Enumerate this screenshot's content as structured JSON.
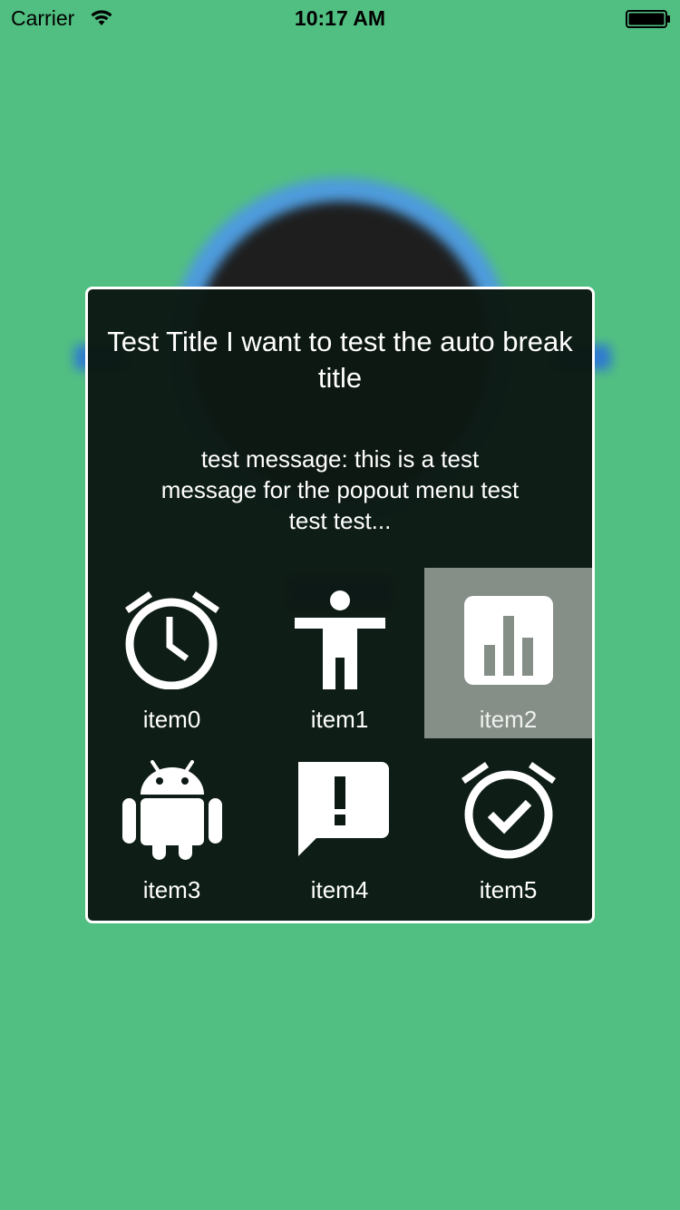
{
  "status_bar": {
    "carrier": "Carrier",
    "time": "10:17 AM",
    "wifi_icon": "wifi-icon",
    "battery_icon": "battery-icon"
  },
  "colors": {
    "background": "#52bf82",
    "popup_background": "#0c1812",
    "popup_border": "#ffffff",
    "selected_item": "#868e88",
    "text": "#ffffff"
  },
  "popup": {
    "title": "Test Title I want to test the auto break title",
    "message": "test message: this is a test message for the popout menu test test test...",
    "selected_index": 2,
    "items": [
      {
        "label": "item0",
        "icon": "alarm-clock-icon"
      },
      {
        "label": "item1",
        "icon": "accessibility-person-icon"
      },
      {
        "label": "item2",
        "icon": "bar-chart-icon"
      },
      {
        "label": "item3",
        "icon": "android-icon"
      },
      {
        "label": "item4",
        "icon": "feedback-alert-icon"
      },
      {
        "label": "item5",
        "icon": "alarm-check-icon"
      }
    ]
  }
}
